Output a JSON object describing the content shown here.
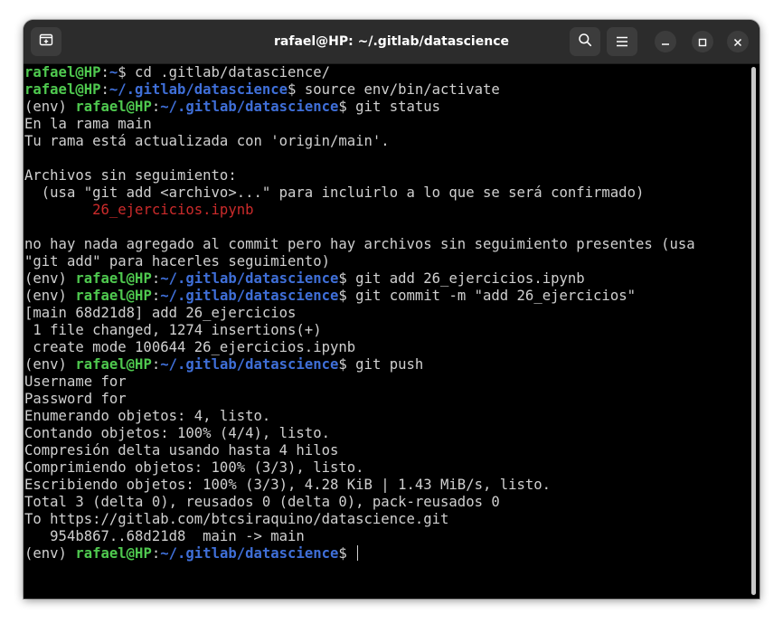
{
  "window": {
    "title": "rafael@HP: ~/.gitlab/datascience"
  },
  "icons": {
    "new_tab": "new-tab-icon",
    "search": "search-icon",
    "menu": "hamburger-menu-icon",
    "minimize": "minimize-icon",
    "maximize": "maximize-icon",
    "close": "close-icon"
  },
  "colors": {
    "user_host": "#4fc94f",
    "path": "#3f6fd8",
    "untracked_file": "#cc2b2b",
    "text": "#d0d0d0",
    "background": "#000000"
  },
  "terminal": {
    "lines": [
      [
        {
          "t": "rafael@HP",
          "c": "u"
        },
        {
          "t": ":"
        },
        {
          "t": "~",
          "c": "p"
        },
        {
          "t": "$ cd .gitlab/datascience/"
        }
      ],
      [
        {
          "t": "rafael@HP",
          "c": "u"
        },
        {
          "t": ":"
        },
        {
          "t": "~/.gitlab/datascience",
          "c": "p"
        },
        {
          "t": "$ source env/bin/activate"
        }
      ],
      [
        {
          "t": "(env) "
        },
        {
          "t": "rafael@HP",
          "c": "u"
        },
        {
          "t": ":"
        },
        {
          "t": "~/.gitlab/datascience",
          "c": "p"
        },
        {
          "t": "$ git status"
        }
      ],
      [
        {
          "t": "En la rama main"
        }
      ],
      [
        {
          "t": "Tu rama está actualizada con 'origin/main'."
        }
      ],
      [
        {
          "t": ""
        }
      ],
      [
        {
          "t": "Archivos sin seguimiento:"
        }
      ],
      [
        {
          "t": "  (usa \"git add <archivo>...\" para incluirlo a lo que se será confirmado)"
        }
      ],
      [
        {
          "t": "        "
        },
        {
          "t": "26_ejercicios.ipynb",
          "c": "red"
        }
      ],
      [
        {
          "t": ""
        }
      ],
      [
        {
          "t": "no hay nada agregado al commit pero hay archivos sin seguimiento presentes (usa"
        }
      ],
      [
        {
          "t": "\"git add\" para hacerles seguimiento)"
        }
      ],
      [
        {
          "t": "(env) "
        },
        {
          "t": "rafael@HP",
          "c": "u"
        },
        {
          "t": ":"
        },
        {
          "t": "~/.gitlab/datascience",
          "c": "p"
        },
        {
          "t": "$ git add 26_ejercicios.ipynb"
        }
      ],
      [
        {
          "t": "(env) "
        },
        {
          "t": "rafael@HP",
          "c": "u"
        },
        {
          "t": ":"
        },
        {
          "t": "~/.gitlab/datascience",
          "c": "p"
        },
        {
          "t": "$ git commit -m \"add 26_ejercicios\""
        }
      ],
      [
        {
          "t": "[main 68d21d8] add 26_ejercicios"
        }
      ],
      [
        {
          "t": " 1 file changed, 1274 insertions(+)"
        }
      ],
      [
        {
          "t": " create mode 100644 26_ejercicios.ipynb"
        }
      ],
      [
        {
          "t": "(env) "
        },
        {
          "t": "rafael@HP",
          "c": "u"
        },
        {
          "t": ":"
        },
        {
          "t": "~/.gitlab/datascience",
          "c": "p"
        },
        {
          "t": "$ git push"
        }
      ],
      [
        {
          "t": "Username for"
        }
      ],
      [
        {
          "t": "Password for"
        }
      ],
      [
        {
          "t": "Enumerando objetos: 4, listo."
        }
      ],
      [
        {
          "t": "Contando objetos: 100% (4/4), listo."
        }
      ],
      [
        {
          "t": "Compresión delta usando hasta 4 hilos"
        }
      ],
      [
        {
          "t": "Comprimiendo objetos: 100% (3/3), listo."
        }
      ],
      [
        {
          "t": "Escribiendo objetos: 100% (3/3), 4.28 KiB | 1.43 MiB/s, listo."
        }
      ],
      [
        {
          "t": "Total 3 (delta 0), reusados 0 (delta 0), pack-reusados 0"
        }
      ],
      [
        {
          "t": "To https://gitlab.com/btcsiraquino/datascience.git"
        }
      ],
      [
        {
          "t": "   954b867..68d21d8  main -> main"
        }
      ],
      [
        {
          "t": "(env) "
        },
        {
          "t": "rafael@HP",
          "c": "u"
        },
        {
          "t": ":"
        },
        {
          "t": "~/.gitlab/datascience",
          "c": "p"
        },
        {
          "t": "$ "
        }
      ]
    ]
  }
}
